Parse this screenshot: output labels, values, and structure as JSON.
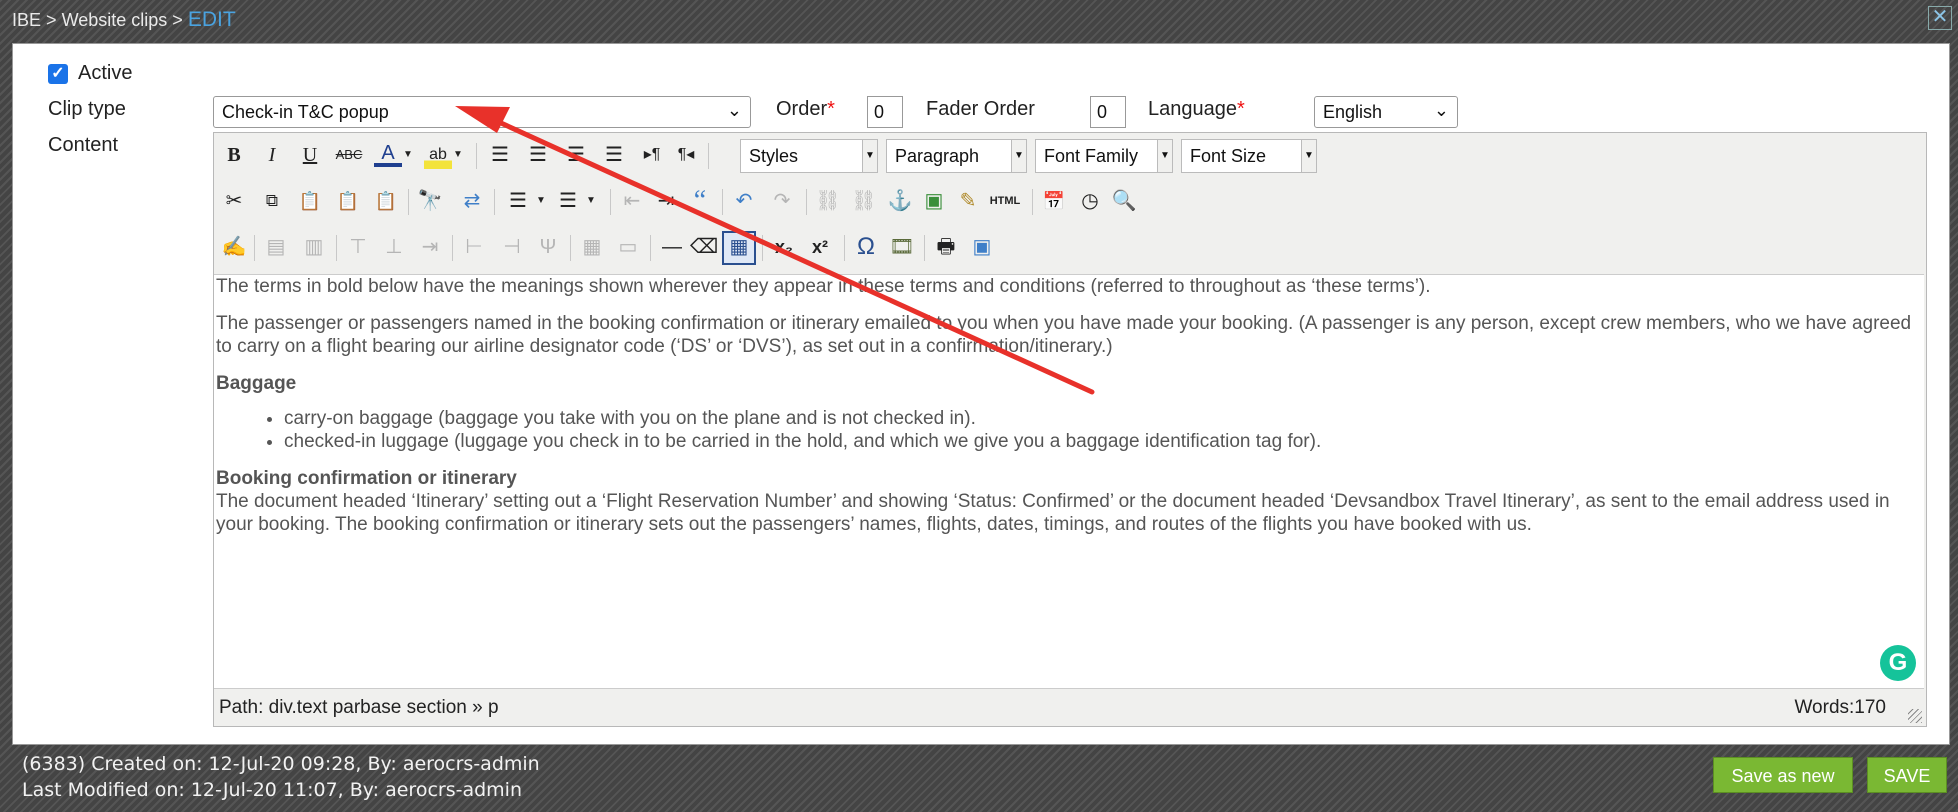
{
  "header": {
    "breadcrumb_root": "IBE",
    "breadcrumb_sep1": ">",
    "breadcrumb_section": "Website clips",
    "breadcrumb_sep2": ">",
    "breadcrumb_current": "EDIT"
  },
  "form": {
    "active_label": "Active",
    "active_checked": true,
    "clip_type_label": "Clip type",
    "clip_type_value": "Check-in T&C popup",
    "order_label": "Order",
    "order_value": "0",
    "fader_order_label": "Fader Order",
    "fader_order_value": "0",
    "language_label": "Language",
    "language_value": "English",
    "required_mark": "*",
    "content_label": "Content"
  },
  "toolbar": {
    "styles": "Styles",
    "paragraph": "Paragraph",
    "font_family": "Font Family",
    "font_size": "Font Size"
  },
  "content": {
    "p1": "The terms in bold below have the meanings shown wherever they appear in these terms and conditions (referred to throughout as ‘these terms’).",
    "p2": "The passenger or passengers named in the booking confirmation or itinerary emailed to you when you have made your booking. (A passenger is any person, except crew members, who we have agreed to carry on a flight bearing our airline designator code (‘DS’ or ‘DVS’), as set out in a confirmation/itinerary.)",
    "h1": "Baggage",
    "li1": "carry-on baggage (baggage you take with you on the plane and is not checked in).",
    "li2": "checked-in luggage (luggage you check in to be carried in the hold, and which we give you a baggage identification tag for).",
    "h2": "Booking confirmation or itinerary",
    "p3": "The document headed ‘Itinerary’ setting out a ‘Flight Reservation Number’ and showing ‘Status: Confirmed’ or the document headed ‘Devsandbox Travel Itinerary’, as sent to the email address used in your booking. The booking confirmation or itinerary sets out the passengers’ names, flights, dates, timings, and routes of the flights you have booked with us."
  },
  "statusbar": {
    "path": "Path: div.text parbase section » p",
    "words": "Words:170"
  },
  "footer": {
    "created": "(6383) Created on: 12-Jul-20 09:28, By: aerocrs-admin",
    "modified": "Last Modified on: 12-Jul-20 11:07, By: aerocrs-admin",
    "save_as_new": "Save as new",
    "save": "SAVE"
  },
  "colors": {
    "accent": "#4aa3e0",
    "button_green": "#7ab833",
    "annotation_arrow": "#e8312a",
    "required": "#e11111"
  },
  "icons": [
    "bold-icon",
    "italic-icon",
    "underline-icon",
    "strikethrough-icon",
    "font-color-icon",
    "highlight-icon",
    "align-left-icon",
    "align-center-icon",
    "align-right-icon",
    "justify-icon",
    "ltr-icon",
    "rtl-icon",
    "cut-icon",
    "copy-icon",
    "paste-icon",
    "paste-text-icon",
    "paste-word-icon",
    "find-icon",
    "replace-icon",
    "bullet-list-icon",
    "numbered-list-icon",
    "outdent-icon",
    "indent-icon",
    "blockquote-icon",
    "undo-icon",
    "redo-icon",
    "link-icon",
    "unlink-icon",
    "anchor-icon",
    "image-icon",
    "cleanup-icon",
    "html-icon",
    "insert-date-icon",
    "insert-time-icon",
    "preview-icon",
    "edit-icon",
    "omega-icon",
    "media-icon",
    "print-icon",
    "fullscreen-icon"
  ]
}
